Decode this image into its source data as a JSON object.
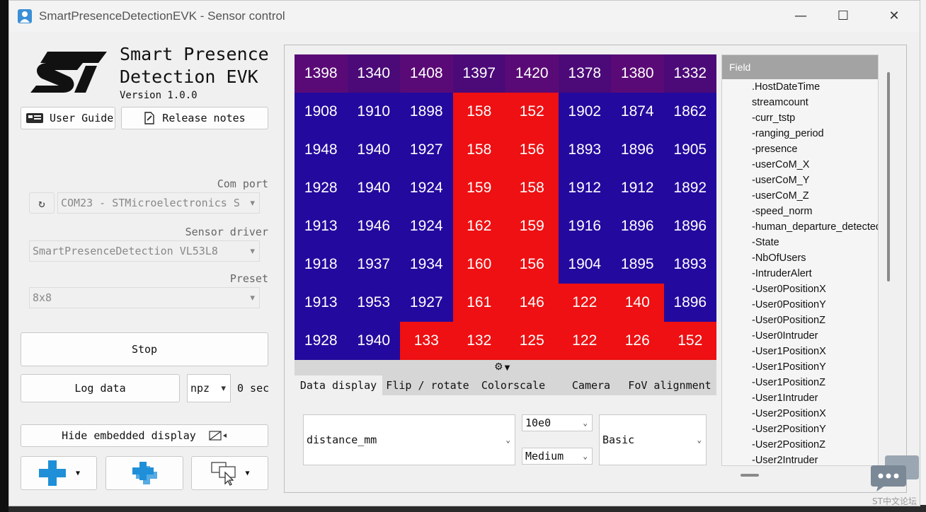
{
  "window": {
    "title": "SmartPresenceDetectionEVK - Sensor control",
    "minimize": "—",
    "maximize": "☐",
    "close": "✕"
  },
  "brand": {
    "title": "Smart Presence\nDetection EVK",
    "version": "Version 1.0.0"
  },
  "buttons": {
    "user_guide": "User Guide",
    "release_notes": "Release notes",
    "stop": "Stop",
    "log_data": "Log data",
    "hide_display": "Hide embedded display"
  },
  "com_port": {
    "label": "Com port",
    "value": "COM23 - STMicroelectronics S"
  },
  "sensor_driver": {
    "label": "Sensor driver",
    "value": "SmartPresenceDetection VL53L8"
  },
  "preset": {
    "label": "Preset",
    "value": "8x8"
  },
  "log": {
    "format": "npz",
    "duration": "0 sec"
  },
  "heatmap": {
    "values": [
      [
        1398,
        1340,
        1408,
        1397,
        1420,
        1378,
        1380,
        1332
      ],
      [
        1908,
        1910,
        1898,
        158,
        152,
        1902,
        1874,
        1862
      ],
      [
        1948,
        1940,
        1927,
        158,
        156,
        1893,
        1896,
        1905
      ],
      [
        1928,
        1940,
        1924,
        159,
        158,
        1912,
        1912,
        1892
      ],
      [
        1913,
        1946,
        1924,
        162,
        159,
        1916,
        1896,
        1896
      ],
      [
        1918,
        1937,
        1934,
        160,
        156,
        1904,
        1895,
        1893
      ],
      [
        1913,
        1953,
        1927,
        161,
        146,
        122,
        140,
        1896
      ],
      [
        1928,
        1940,
        133,
        132,
        125,
        122,
        126,
        152
      ]
    ],
    "colors": {
      "far": "#24099e",
      "near": "#ee1012",
      "top": "#5a0a76",
      "top_alt": "#4b0a78"
    }
  },
  "tabs": [
    "Data display",
    "Flip / rotate",
    "Colorscale",
    "Camera",
    "FoV alignment"
  ],
  "display_controls": {
    "data_field": "distance_mm",
    "scale": "10e0",
    "size": "Medium",
    "mode": "Basic"
  },
  "field_list": {
    "header": "Field",
    "items": [
      ".HostDateTime",
      "streamcount",
      "-curr_tstp",
      "-ranging_period",
      "-presence",
      "-userCoM_X",
      "-userCoM_Y",
      "-userCoM_Z",
      "-speed_norm",
      "-human_departure_detected",
      "-State",
      "-NbOfUsers",
      "-IntruderAlert",
      "-User0PositionX",
      "-User0PositionY",
      "-User0PositionZ",
      "-User0Intruder",
      "-User1PositionX",
      "-User1PositionY",
      "-User1PositionZ",
      "-User1Intruder",
      "-User2PositionX",
      "-User2PositionY",
      "-User2PositionZ",
      "-User2Intruder"
    ]
  },
  "watermark": "ST中文论坛"
}
